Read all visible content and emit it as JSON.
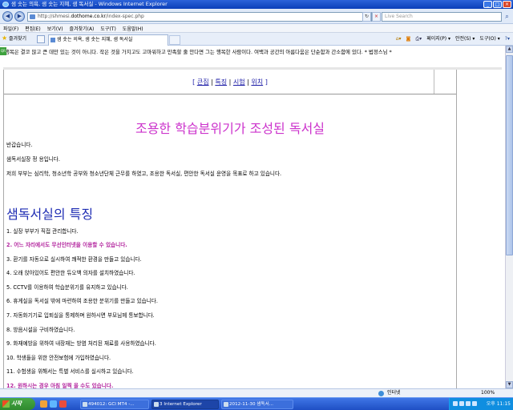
{
  "window": {
    "title": "샘 솟는 의욕, 샘 솟는 지혜, 샘 독서실 - Windows Internet Explorer",
    "minimize": "_",
    "maximize": "□",
    "close": "×"
  },
  "addressbar": {
    "back": "◀",
    "forward": "▶",
    "url_prefix": "http://shmesi.",
    "url_domain": "dothome.co.kr",
    "url_suffix": "/index-spec.php",
    "refresh": "↻",
    "stop": "×",
    "search_placeholder": "Live Search",
    "search_icon": "search-icon"
  },
  "menubar": {
    "items": [
      "파일(F)",
      "편집(E)",
      "보기(V)",
      "즐겨찾기(A)",
      "도구(T)",
      "도움말(H)"
    ]
  },
  "tabrow": {
    "favorites_label": "즐겨찾기",
    "tab_title": "샘 솟는 의욕, 샘 솟는 지혜, 샘 독서실",
    "commands": [
      "페이지(P) ▾",
      "안전(S) ▾",
      "도구(O) ▾"
    ]
  },
  "content": {
    "quote_badge": "QR",
    "quote": "행복은 결코 많고 큰 데만 있는 것이 아니다. 작은 것을 가지고도 고마워하고 만족할 줄 안다면 그는 행복한 사람이다. 여백과 공간의 아름다움은 단순함과 간소함에 있다. * 법정스님 *",
    "nav": {
      "bracket_open": "[",
      "bracket_close": "]",
      "sep": "|",
      "links": [
        "큰집",
        "특징",
        "시험",
        "위치"
      ]
    },
    "heading1": "조용한 학습분위기가 조성된 독서실",
    "paragraphs": [
      "반갑습니다.",
      "샘독서실장 정 용입니다.",
      "저희 부부는 심리학, 청소년학 공부와 청소년단체 근무를 하였고, 조용한 독서실, 편안한 독서실 운영을 목표로 하고 있습니다."
    ],
    "heading2": "샘독서실의 특징",
    "features": [
      "1. 실장 부부가 직접 관리합니다.",
      "2. 어느 자리에서도 무선인터넷을 이용할 수 있습니다.",
      "3. 환기를 자동으로 실시하여 쾌적한 환경을 만들고 있습니다.",
      "4. 오래 앉아있어도 편안한 듀오백 의자를 설치하였습니다.",
      "5. CCTV를 이용하여 학습분위기를 유지하고 있습니다.",
      "6. 휴게실을 독서실 밖에 마련하여 조용한 분위기를 만들고 있습니다.",
      "7. 자동화기기로 입퇴실을 통제하며 원하시면 부모님께 통보합니다.",
      "8. 방음시설을 구비하였습니다.",
      "9. 화재예방을 위하여 내장재는 방염 처리된 재료를 사용하였습니다.",
      "10. 학생들을 위한 안전보험에 가입하였습니다.",
      "11. 수험생을 위해서는 특별 서비스를 실시하고 있습니다.",
      "12. 원하시는 경우 아침 일찍 올 수도 있습니다."
    ],
    "highlighted_feature_indices": [
      1,
      11
    ]
  },
  "statusbar": {
    "zone": "인터넷",
    "zoom": "100%"
  },
  "taskbar": {
    "start": "시작",
    "tasks": [
      "494012: GCI MT4 -...",
      "3 Internet Explorer",
      "2012-11-30 샘독서..."
    ],
    "active_task_index": 1,
    "clock": "오후 11:15"
  },
  "colors": {
    "heading1": "#cc33cc",
    "heading2": "#1f2db3",
    "highlight": "#b3259e",
    "link": "#1a1aa6"
  }
}
